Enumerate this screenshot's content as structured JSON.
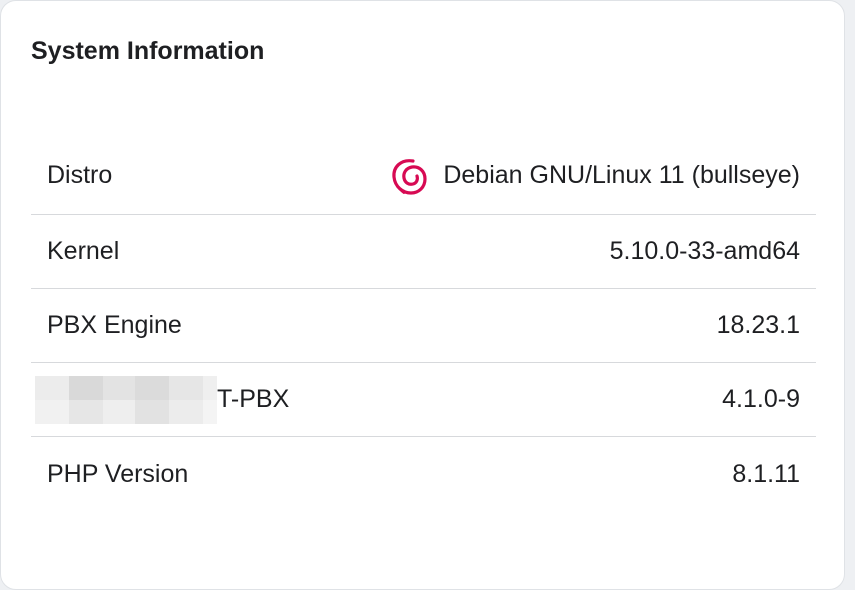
{
  "card": {
    "title": "System Information"
  },
  "rows": [
    {
      "label": "Distro",
      "value": "Debian GNU/Linux 11 (bullseye)",
      "icon": "debian-swirl-icon",
      "icon_color": "#d70a53"
    },
    {
      "label": "Kernel",
      "value": "5.10.0-33-amd64"
    },
    {
      "label": "PBX Engine",
      "value": "18.23.1"
    },
    {
      "label": "T-PBX",
      "value": "4.1.0-9",
      "label_obscured": true
    },
    {
      "label": "PHP Version",
      "value": "8.1.11"
    }
  ]
}
